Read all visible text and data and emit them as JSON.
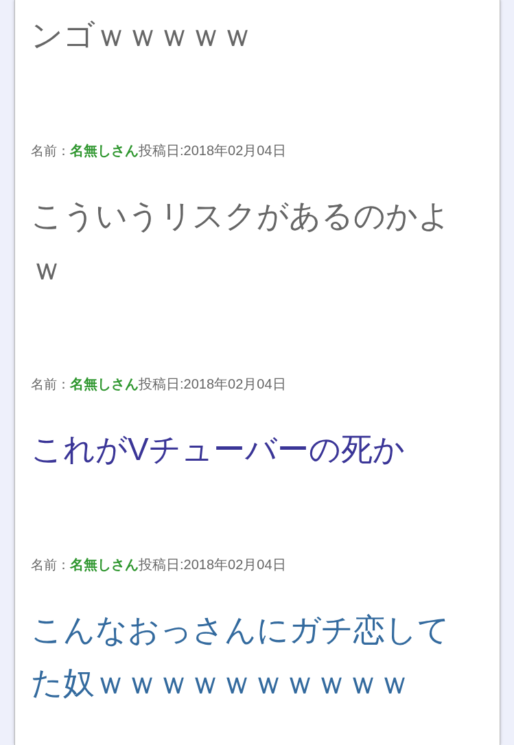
{
  "posts": [
    {
      "text": "ンゴｗｗｗｗｗ",
      "color": "#666666"
    },
    {
      "meta": {
        "label": "名前：",
        "name": "名無しさん",
        "date": "投稿日:2018年02月04日"
      },
      "text": "こういうリスクがあるのかよｗ",
      "color": "#666666"
    },
    {
      "meta": {
        "label": "名前：",
        "name": "名無しさん",
        "date": "投稿日:2018年02月04日"
      },
      "text": "これがVチューバーの死か",
      "color": "#3a3597"
    },
    {
      "meta": {
        "label": "名前：",
        "name": "名無しさん",
        "date": "投稿日:2018年02月04日"
      },
      "text": "こんなおっさんにガチ恋してた奴ｗｗｗｗｗｗｗｗｗｗ",
      "color": "#336a9e"
    }
  ]
}
